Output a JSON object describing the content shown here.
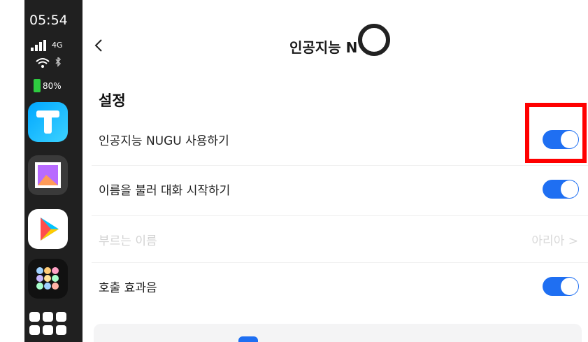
{
  "status": {
    "time": "05:54",
    "network": "4G",
    "battery": "80%"
  },
  "header": {
    "title": "인공지능 N"
  },
  "section": {
    "title": "설정"
  },
  "rows": [
    {
      "label": "인공지능 NUGU 사용하기",
      "toggle": "on"
    },
    {
      "label": "이름을 불러 대화 시작하기",
      "toggle": "on"
    },
    {
      "label": "부르는 이름",
      "value": "아리아 >",
      "state": "disabled"
    },
    {
      "label": "호출 효과음",
      "toggle": "on"
    }
  ],
  "colors": {
    "accent": "#1f6ff2",
    "highlight": "#ff0000"
  }
}
